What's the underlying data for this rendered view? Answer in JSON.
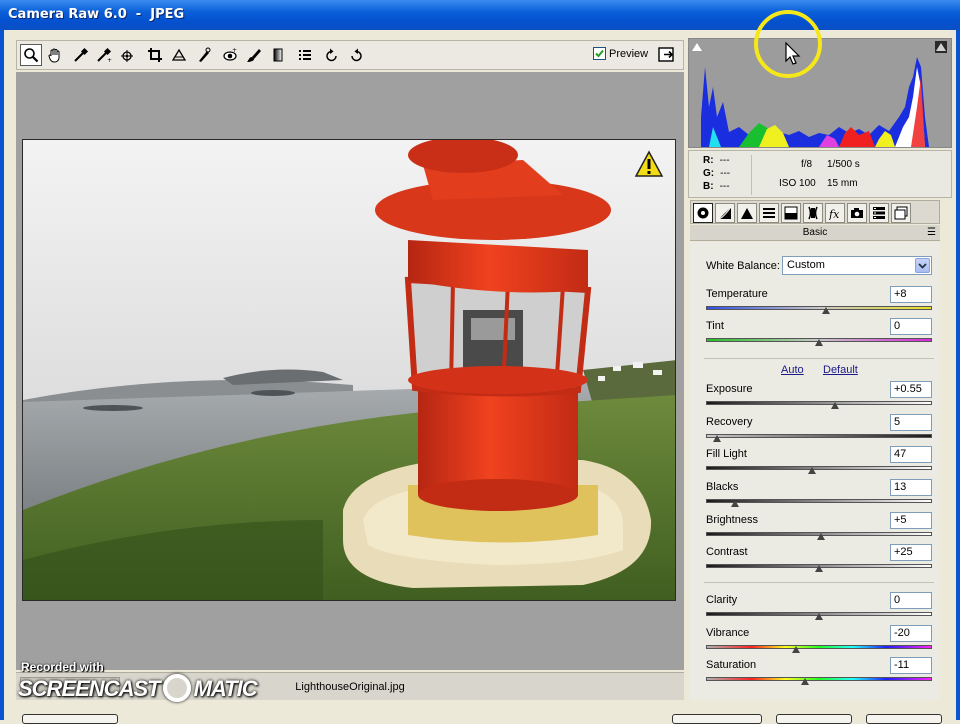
{
  "window": {
    "title": "Camera Raw 6.0  -  JPEG"
  },
  "toolbar": {
    "tools": [
      {
        "name": "zoom-tool-icon",
        "active": true
      },
      {
        "name": "hand-tool-icon"
      },
      {
        "name": "white-balance-tool-icon"
      },
      {
        "name": "color-sampler-tool-icon"
      },
      {
        "name": "targeted-adjustment-tool-icon"
      },
      {
        "name": "crop-tool-icon"
      },
      {
        "name": "straighten-tool-icon"
      },
      {
        "name": "spot-removal-tool-icon"
      },
      {
        "name": "red-eye-removal-tool-icon"
      },
      {
        "name": "adjustment-brush-icon"
      },
      {
        "name": "graduated-filter-icon"
      },
      {
        "name": "preferences-icon"
      },
      {
        "name": "rotate-left-icon"
      },
      {
        "name": "rotate-right-icon"
      }
    ],
    "preview_label": "Preview",
    "preview_checked": true
  },
  "status": {
    "filename": "LighthouseOriginal.jpg"
  },
  "watermark": {
    "line1": "Recorded with",
    "brand_left": "SCREENCAST",
    "brand_right": "MATIC"
  },
  "readout": {
    "r_label": "R:",
    "r_value": "---",
    "g_label": "G:",
    "g_value": "---",
    "b_label": "B:",
    "b_value": "---",
    "aperture": "f/8",
    "shutter": "1/500 s",
    "iso": "ISO 100",
    "focal": "15 mm"
  },
  "panel": {
    "title": "Basic",
    "tabs": [
      "basic-tab-icon",
      "tone-curve-tab-icon",
      "detail-tab-icon",
      "hsl-tab-icon",
      "split-toning-tab-icon",
      "lens-corrections-tab-icon",
      "effects-tab-icon",
      "camera-calibration-tab-icon",
      "presets-tab-icon",
      "snapshots-tab-icon"
    ]
  },
  "white_balance": {
    "label": "White Balance:",
    "value": "Custom"
  },
  "links": {
    "auto": "Auto",
    "default": "Default"
  },
  "sliders": [
    {
      "label": "Temperature",
      "value": "+8",
      "level": 0.53,
      "track": "temp"
    },
    {
      "label": "Tint",
      "value": "0",
      "level": 0.5,
      "track": "tint"
    },
    {
      "label": "Exposure",
      "value": "+0.55",
      "level": 0.57,
      "track": "gray"
    },
    {
      "label": "Recovery",
      "value": "5",
      "level": 0.05,
      "track": "dark"
    },
    {
      "label": "Fill Light",
      "value": "47",
      "level": 0.47,
      "track": "gray"
    },
    {
      "label": "Blacks",
      "value": "13",
      "level": 0.13,
      "track": "gray"
    },
    {
      "label": "Brightness",
      "value": "+5",
      "level": 0.51,
      "track": "gray"
    },
    {
      "label": "Contrast",
      "value": "+25",
      "level": 0.5,
      "track": "gray"
    },
    {
      "label": "Clarity",
      "value": "0",
      "level": 0.5,
      "track": "gray"
    },
    {
      "label": "Vibrance",
      "value": "-20",
      "level": 0.4,
      "track": "color"
    },
    {
      "label": "Saturation",
      "value": "-11",
      "level": 0.44,
      "track": "color"
    }
  ],
  "colors": {
    "accent": "#0a54d0",
    "cursor_highlight": "#f6e71a",
    "lighthouse_red": "#e43a1c"
  }
}
